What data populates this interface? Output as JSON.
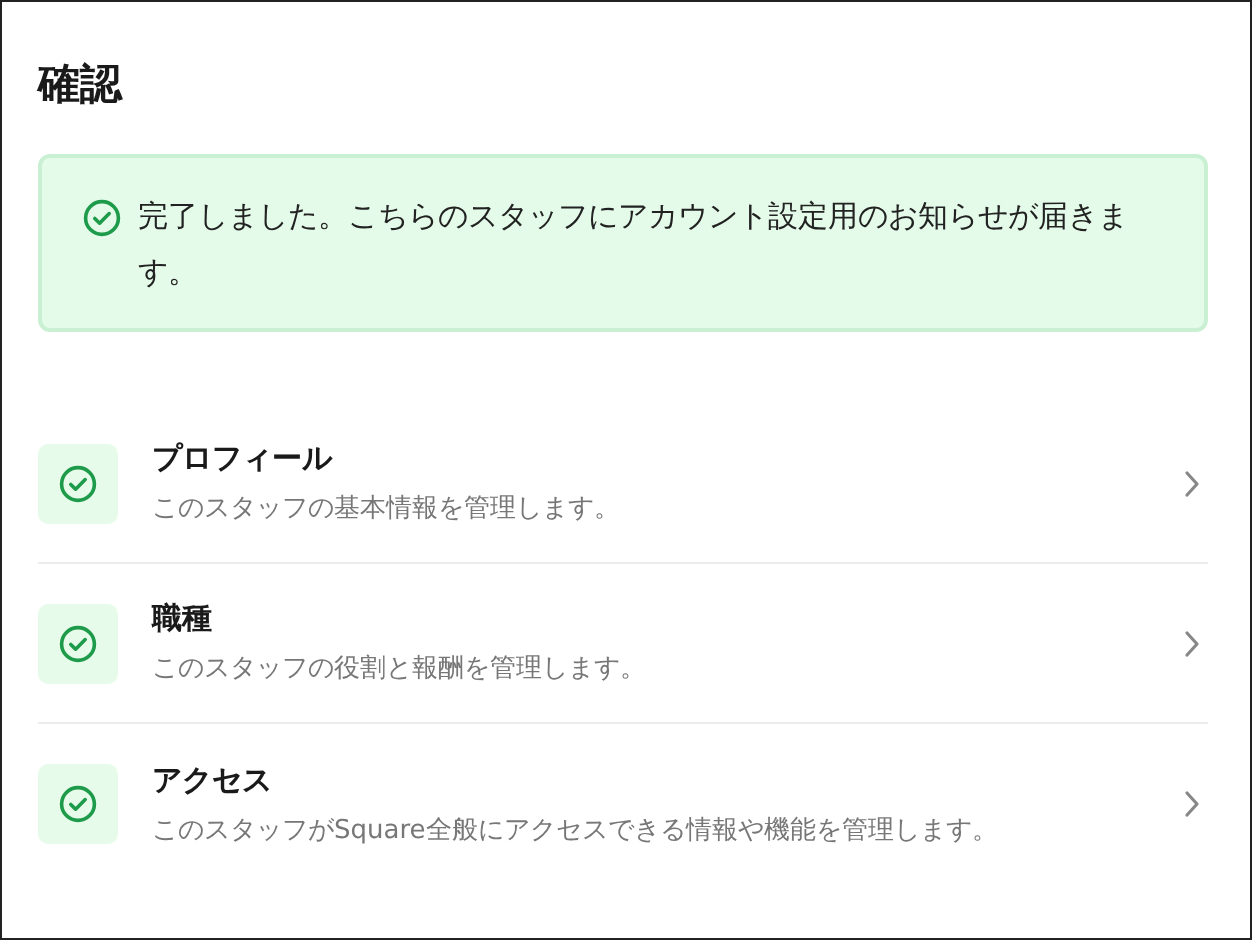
{
  "title": "確認",
  "banner": {
    "message": "完了しました。こちらのスタッフにアカウント設定用のお知らせが届きます。"
  },
  "items": [
    {
      "title": "プロフィール",
      "description": "このスタッフの基本情報を管理します。"
    },
    {
      "title": "職種",
      "description": "このスタッフの役割と報酬を管理します。"
    },
    {
      "title": "アクセス",
      "description": "このスタッフがSquare全般にアクセスできる情報や機能を管理します。"
    }
  ]
}
